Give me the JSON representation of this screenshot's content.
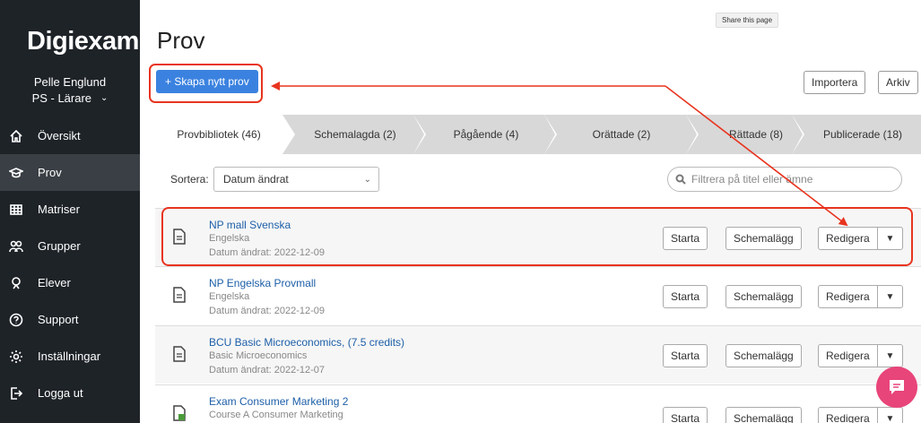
{
  "app": {
    "logo": "Digiexam"
  },
  "user": {
    "name": "Pelle Englund",
    "role": "PS - Lärare"
  },
  "nav": [
    {
      "label": "Översikt",
      "icon": "home-icon",
      "active": false
    },
    {
      "label": "Prov",
      "icon": "graduation-cap-icon",
      "active": true
    },
    {
      "label": "Matriser",
      "icon": "grid-icon",
      "active": false
    },
    {
      "label": "Grupper",
      "icon": "group-icon",
      "active": false
    },
    {
      "label": "Elever",
      "icon": "student-icon",
      "active": false
    },
    {
      "label": "Support",
      "icon": "help-icon",
      "active": false
    },
    {
      "label": "Inställningar",
      "icon": "gear-icon",
      "active": false
    },
    {
      "label": "Logga ut",
      "icon": "logout-icon",
      "active": false
    }
  ],
  "tooltip": "Share this page",
  "page": {
    "title": "Prov"
  },
  "toolbar": {
    "create": "+ Skapa nytt prov",
    "import": "Importera",
    "archive": "Arkiv"
  },
  "tabs": [
    {
      "label": "Provbibliotek (46)",
      "active": true
    },
    {
      "label": "Schemalagda (2)",
      "active": false
    },
    {
      "label": "Pågående (4)",
      "active": false
    },
    {
      "label": "Orättade (2)",
      "active": false
    },
    {
      "label": "Rättade (8)",
      "active": false
    },
    {
      "label": "Publicerade (18)",
      "active": false
    }
  ],
  "sort": {
    "label": "Sortera:",
    "value": "Datum ändrat"
  },
  "filter": {
    "placeholder": "Filtrera på titel eller ämne"
  },
  "actions": {
    "start": "Starta",
    "schedule": "Schemalägg",
    "edit": "Redigera"
  },
  "exams": [
    {
      "title": "NP mall Svenska",
      "subject": "Engelska",
      "date": "Datum ändrat: 2022-12-09",
      "icon": "document-icon"
    },
    {
      "title": "NP Engelska Provmall",
      "subject": "Engelska",
      "date": "Datum ändrat: 2022-12-09",
      "icon": "document-icon"
    },
    {
      "title": "BCU Basic Microeconomics, (7.5 credits)",
      "subject": "Basic Microeconomics",
      "date": "Datum ändrat: 2022-12-07",
      "icon": "document-icon"
    },
    {
      "title": "Exam Consumer Marketing 2",
      "subject": "Course A Consumer Marketing",
      "date": "",
      "icon": "spreadsheet-document-icon"
    }
  ],
  "colors": {
    "sidebar": "#1e2328",
    "accent": "#3b82e0",
    "annotation": "#e8341f",
    "chat": "#e8457a",
    "link": "#1d5fa8"
  }
}
